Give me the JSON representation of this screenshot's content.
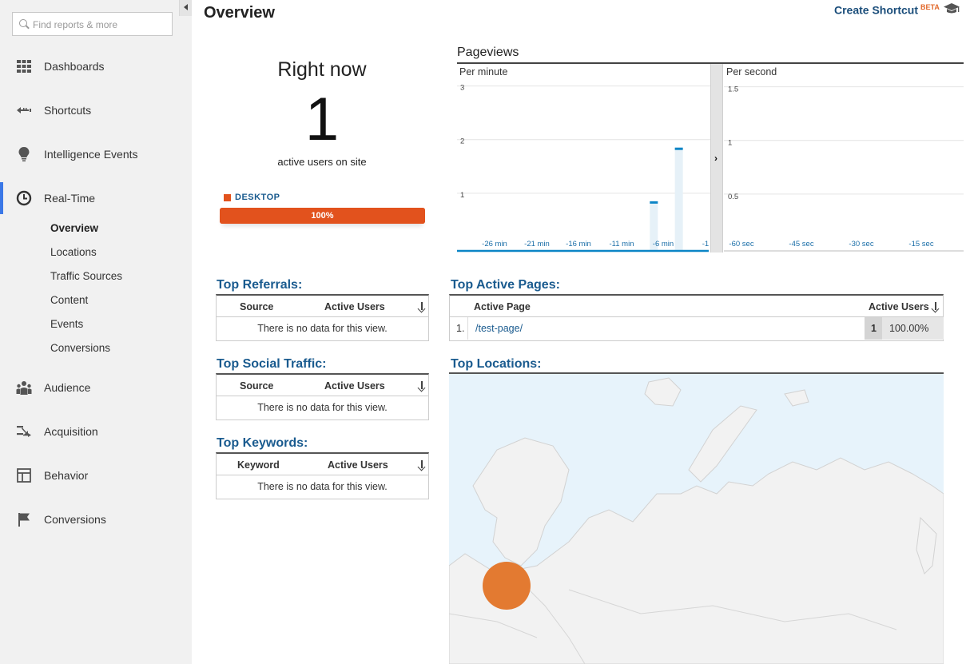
{
  "sidebar": {
    "search_placeholder": "Find reports & more",
    "nav": [
      {
        "label": "Dashboards",
        "icon": "dashboards-icon"
      },
      {
        "label": "Shortcuts",
        "icon": "shortcuts-icon"
      },
      {
        "label": "Intelligence Events",
        "icon": "lightbulb-icon"
      },
      {
        "label": "Real-Time",
        "icon": "clock-icon"
      },
      {
        "label": "Audience",
        "icon": "people-icon"
      },
      {
        "label": "Acquisition",
        "icon": "acquisition-arrows-icon"
      },
      {
        "label": "Behavior",
        "icon": "behavior-layout-icon"
      },
      {
        "label": "Conversions",
        "icon": "flag-icon"
      }
    ],
    "realtime_sub": [
      "Overview",
      "Locations",
      "Traffic Sources",
      "Content",
      "Events",
      "Conversions"
    ],
    "active_sub": "Overview"
  },
  "header": {
    "title": "Overview",
    "shortcut_label": "Create Shortcut",
    "shortcut_badge": "BETA"
  },
  "right_now": {
    "title": "Right now",
    "count": "1",
    "subtitle": "active users on site",
    "device_label": "DESKTOP",
    "device_percent_label": "100%",
    "device_fraction": 1.0,
    "device_color": "#e2521d"
  },
  "pageviews": {
    "title": "Pageviews",
    "per_minute_label": "Per minute",
    "per_second_label": "Per second"
  },
  "chart_data": [
    {
      "type": "bar",
      "title": "Per minute",
      "xlabel": "",
      "ylabel": "",
      "ylim": [
        0,
        3.5
      ],
      "yticks": [
        "1",
        "2",
        "3"
      ],
      "xtick_labels": [
        "-26 min",
        "-21 min",
        "-16 min",
        "-11 min",
        "-6 min",
        "-1"
      ],
      "x": [
        -7,
        -4
      ],
      "values": [
        1,
        2
      ],
      "bar_color": "#0b85c6"
    },
    {
      "type": "bar",
      "title": "Per second",
      "xlabel": "",
      "ylabel": "",
      "ylim": [
        0,
        1.75
      ],
      "yticks": [
        "0.5",
        "1",
        "1.5"
      ],
      "xtick_labels": [
        "-60 sec",
        "-45 sec",
        "-30 sec",
        "-15 sec"
      ],
      "values": []
    }
  ],
  "top_referrals": {
    "title": "Top Referrals:",
    "col1": "Source",
    "col2": "Active Users",
    "empty": "There is no data for this view."
  },
  "top_social": {
    "title": "Top Social Traffic:",
    "col1": "Source",
    "col2": "Active Users",
    "empty": "There is no data for this view."
  },
  "top_keywords": {
    "title": "Top Keywords:",
    "col1": "Keyword",
    "col2": "Active Users",
    "empty": "There is no data for this view."
  },
  "top_pages": {
    "title": "Top Active Pages:",
    "col1": "Active Page",
    "col2": "Active Users",
    "rows": [
      {
        "rank": "1.",
        "page": "/test-page/",
        "users": "1",
        "percent": "100.00%",
        "fraction": 1.0
      }
    ]
  },
  "top_locations": {
    "title": "Top Locations:",
    "marker_color": "#e37a31"
  }
}
